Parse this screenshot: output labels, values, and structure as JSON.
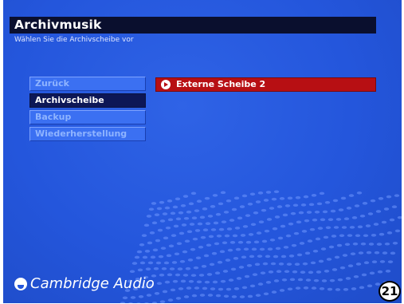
{
  "header": {
    "title": "Archivmusik",
    "subtitle": "Wählen Sie die Archivscheibe vor"
  },
  "menu": {
    "items": [
      {
        "label": "Zurück",
        "selected": false
      },
      {
        "label": "Archivscheibe",
        "selected": true
      },
      {
        "label": "Backup",
        "selected": false
      },
      {
        "label": "Wiederherstellung",
        "selected": false
      }
    ]
  },
  "option": {
    "label": "Externe Scheibe 2",
    "icon": "play-circle-icon"
  },
  "brand": {
    "text": "Cambridge Audio",
    "icon": "cambridge-audio-logo-icon"
  },
  "page_number": "21",
  "colors": {
    "background": "#2456dc",
    "title_bar": "#0a0f2e",
    "menu_selected": "#0d1756",
    "menu_normal": "#3b70f2",
    "option_highlight": "#b70f13"
  }
}
